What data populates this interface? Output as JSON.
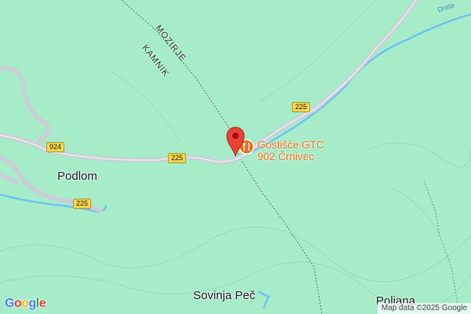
{
  "places": {
    "podlom": "Podlom",
    "sovinja_pec": "Sovinja Peč",
    "poljana": "Poljana"
  },
  "poi": {
    "line1": "Gostišče GTC",
    "line2": "902 Črnivec",
    "category": "restaurant-icon"
  },
  "boundary_labels": {
    "mozirje": "MOZIRJE",
    "kamnik": "KAMNIK"
  },
  "river_label": "Dreta",
  "road_shields": {
    "r924": "924",
    "r225_a": "225",
    "r225_b": "225",
    "r225_c": "225"
  },
  "logo": {
    "text": "Google",
    "letters": [
      "G",
      "o",
      "o",
      "g",
      "l",
      "e"
    ],
    "colors": [
      "#4285F4",
      "#EA4335",
      "#FBBC05",
      "#4285F4",
      "#34A853",
      "#EA4335"
    ]
  },
  "attribution": "Map data ©2025 Google",
  "colors": {
    "land": "#a6ecc9",
    "road": "#c9ced6",
    "river": "#6fc3ef",
    "pin": "#ea4335",
    "poi": "#e8711a",
    "shield": "#f7d64a"
  }
}
